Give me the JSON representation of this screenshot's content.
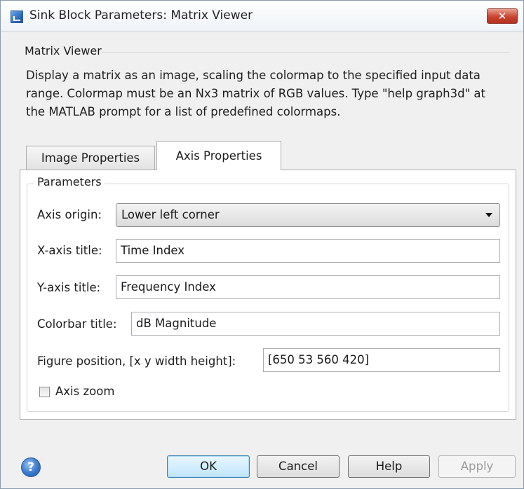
{
  "window": {
    "title": "Sink Block Parameters: Matrix Viewer",
    "close_label": "✕"
  },
  "group": {
    "label": "Matrix Viewer",
    "description": "Display a matrix as an image, scaling the colormap to the specified input data range.  Colormap must be an Nx3 matrix of RGB values.  Type \"help graph3d\" at the MATLAB prompt for a list of predefined colormaps."
  },
  "tabs": [
    {
      "label": "Image Properties",
      "selected": false
    },
    {
      "label": "Axis Properties",
      "selected": true
    }
  ],
  "parameters": {
    "label": "Parameters",
    "axis_origin": {
      "label": "Axis origin:",
      "value": "Lower left corner"
    },
    "x_axis_title": {
      "label": "X-axis title:",
      "value": "Time Index"
    },
    "y_axis_title": {
      "label": "Y-axis title:",
      "value": "Frequency Index"
    },
    "colorbar_title": {
      "label": "Colorbar title:",
      "value": "dB Magnitude"
    },
    "figure_position": {
      "label": "Figure position, [x y width height]:",
      "value": "[650 53 560 420]"
    },
    "axis_zoom": {
      "label": "Axis zoom",
      "checked": false
    }
  },
  "buttons": {
    "help_icon": "?",
    "ok": "OK",
    "cancel": "Cancel",
    "help": "Help",
    "apply": "Apply"
  },
  "colors": {
    "window_bg": "#f0f0f0",
    "panel_bg": "#ffffff",
    "close_button": "#c84430",
    "ok_button": "#bee6fd"
  }
}
